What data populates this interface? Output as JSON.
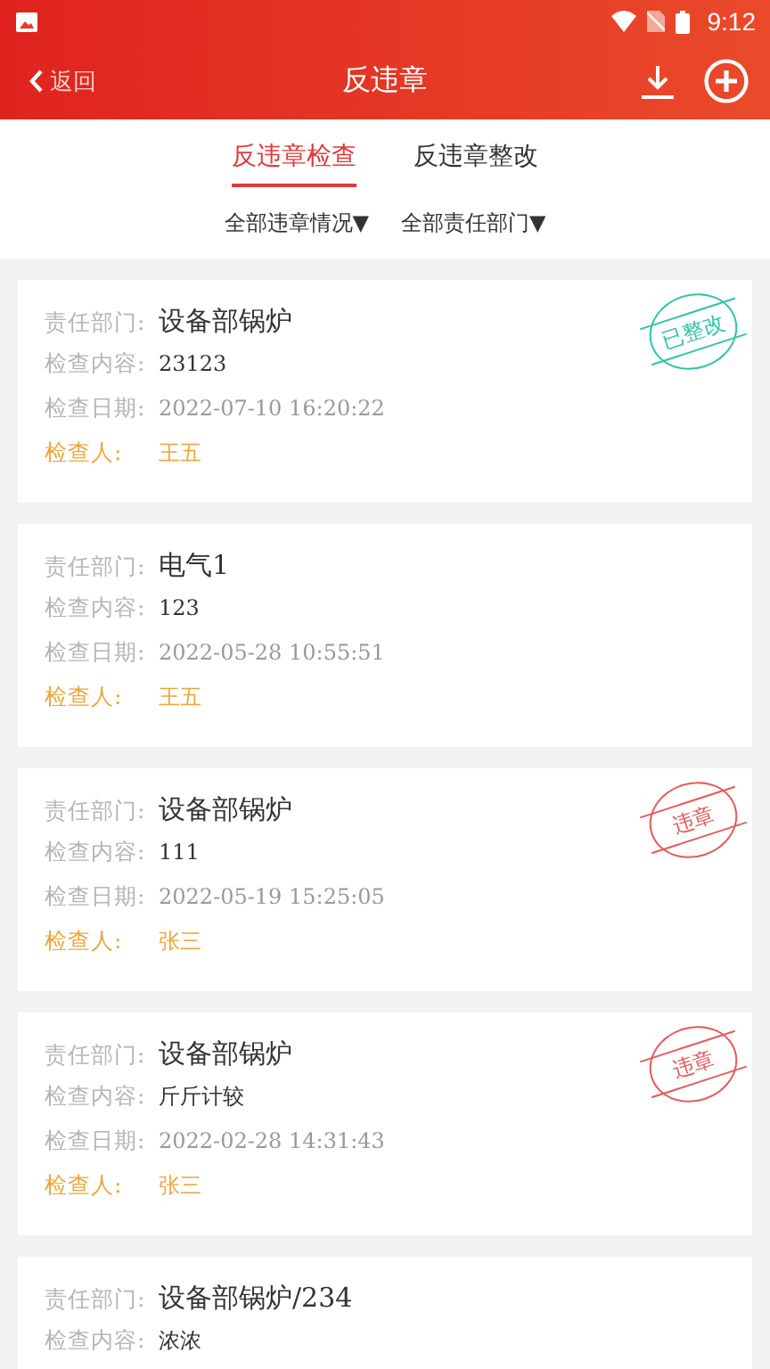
{
  "status_bar": {
    "time": "9:12"
  },
  "header": {
    "back": "返回",
    "title": "反违章"
  },
  "tabs": [
    {
      "label": "反违章检查",
      "selected": true
    },
    {
      "label": "反违章整改",
      "selected": false
    }
  ],
  "filters": [
    {
      "label": "全部违章情况",
      "symbol": "▼"
    },
    {
      "label": "全部责任部门",
      "symbol": "▼"
    }
  ],
  "records": [
    {
      "stamp": {
        "kind": "rectified",
        "text": "已整改"
      },
      "fields": [
        {
          "kind": "department",
          "label": "责任部门:",
          "value": "设备部锅炉"
        },
        {
          "kind": "content",
          "label": "检查内容:",
          "value": "23123"
        },
        {
          "kind": "date",
          "label": "检查日期:",
          "value": "2022-07-10 16:20:22"
        },
        {
          "kind": "inspector",
          "label": "检查人:",
          "value": "王五"
        }
      ]
    },
    {
      "fields": [
        {
          "kind": "department",
          "label": "责任部门:",
          "value": "电气1"
        },
        {
          "kind": "content",
          "label": "检查内容:",
          "value": "123"
        },
        {
          "kind": "date",
          "label": "检查日期:",
          "value": "2022-05-28 10:55:51"
        },
        {
          "kind": "inspector",
          "label": "检查人:",
          "value": "王五"
        }
      ]
    },
    {
      "stamp": {
        "kind": "violation",
        "text": "违章"
      },
      "fields": [
        {
          "kind": "department",
          "label": "责任部门:",
          "value": "设备部锅炉"
        },
        {
          "kind": "content",
          "label": "检查内容:",
          "value": "111"
        },
        {
          "kind": "date",
          "label": "检查日期:",
          "value": "2022-05-19 15:25:05"
        },
        {
          "kind": "inspector",
          "label": "检查人:",
          "value": "张三"
        }
      ]
    },
    {
      "stamp": {
        "kind": "violation",
        "text": "违章"
      },
      "fields": [
        {
          "kind": "department",
          "label": "责任部门:",
          "value": "设备部锅炉"
        },
        {
          "kind": "content",
          "label": "检查内容:",
          "value": "斤斤计较"
        },
        {
          "kind": "date",
          "label": "检查日期:",
          "value": "2022-02-28 14:31:43"
        },
        {
          "kind": "inspector",
          "label": "检查人:",
          "value": "张三"
        }
      ]
    },
    {
      "fields": [
        {
          "kind": "department",
          "label": "责任部门:",
          "value": "设备部锅炉/234"
        },
        {
          "kind": "content",
          "label": "检查内容:",
          "value": "浓浓"
        }
      ]
    }
  ]
}
